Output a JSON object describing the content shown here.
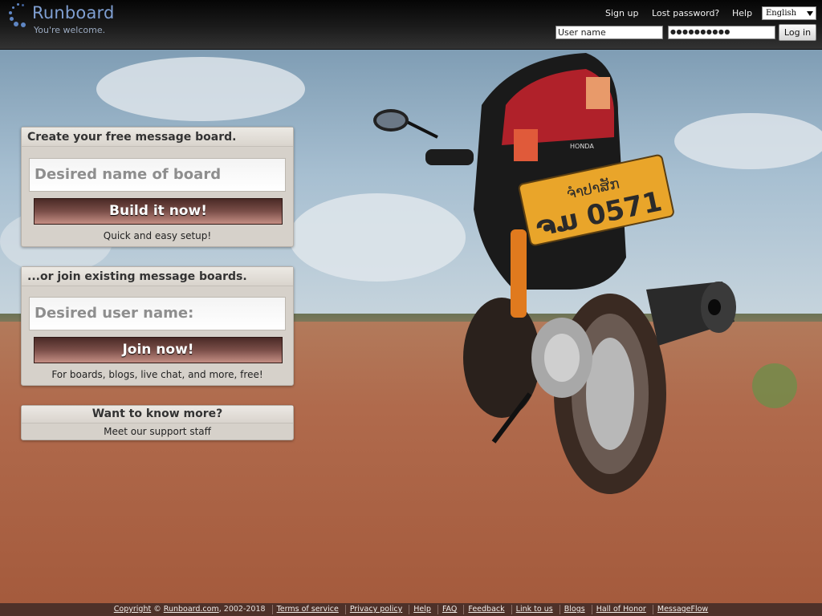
{
  "brand": {
    "name": "Runboard",
    "tagline": "You're welcome.",
    "accent_color": "#7f9fd2"
  },
  "header": {
    "links": [
      "Sign up",
      "Lost password?",
      "Help"
    ],
    "language": "English",
    "username_value": "User name",
    "password_value": "●●●●●●●●●●",
    "login_label": "Log in"
  },
  "create_panel": {
    "title": "Create your free message board.",
    "input_placeholder": "Desired name of board",
    "button_label": "Build it now!",
    "note": "Quick and easy setup!"
  },
  "join_panel": {
    "title": "...or join existing message boards.",
    "input_placeholder": "Desired user name:",
    "button_label": "Join now!",
    "note": "For boards, blogs, live chat, and more, free!"
  },
  "more_panel": {
    "title": "Want to know more?",
    "link": "Meet our support staff"
  },
  "scene": {
    "plate_top": "ຈຳປາສັກ",
    "plate_bottom": "ຈມ 0571",
    "bike_brand": "HONDA"
  },
  "footer": {
    "copyright_link": "Copyright",
    "copyright_symbol": "©",
    "site_link": "Runboard.com",
    "years": ", 2002-2018",
    "links": [
      "Terms of service",
      "Privacy policy",
      "Help",
      "FAQ",
      "Feedback",
      "Link to us",
      "Blogs",
      "Hall of Honor",
      "MessageFlow"
    ]
  }
}
